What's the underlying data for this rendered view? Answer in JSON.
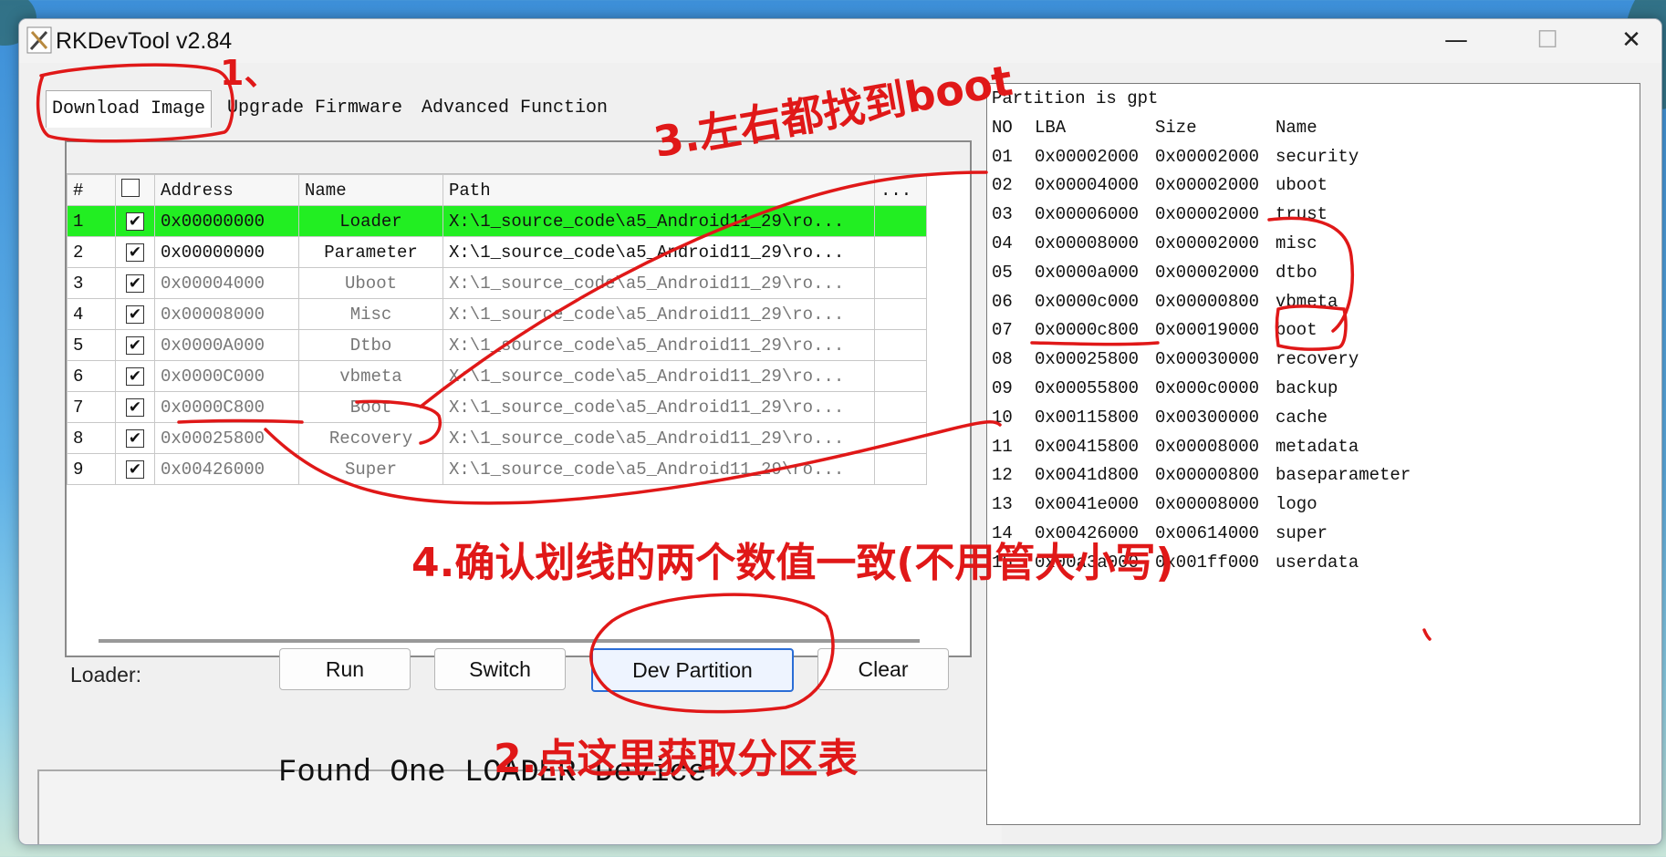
{
  "window": {
    "title": "RKDevTool v2.84",
    "min": "—",
    "max": "☐",
    "close": "✕"
  },
  "tabs": [
    "Download Image",
    "Upgrade Firmware",
    "Advanced Function"
  ],
  "grid": {
    "headers": [
      "#",
      "",
      "Address",
      "Name",
      "Path",
      "..."
    ],
    "rows": [
      {
        "num": "1",
        "checked": "✔",
        "address": "0x00000000",
        "name": "Loader",
        "path": "X:\\1_source_code\\a5_Android11_29\\ro..."
      },
      {
        "num": "2",
        "checked": "✔",
        "address": "0x00000000",
        "name": "Parameter",
        "path": "X:\\1_source_code\\a5_Android11_29\\ro..."
      },
      {
        "num": "3",
        "checked": "✔",
        "address": "0x00004000",
        "name": "Uboot",
        "path": "X:\\1_source_code\\a5_Android11_29\\ro..."
      },
      {
        "num": "4",
        "checked": "✔",
        "address": "0x00008000",
        "name": "Misc",
        "path": "X:\\1_source_code\\a5_Android11_29\\ro..."
      },
      {
        "num": "5",
        "checked": "✔",
        "address": "0x0000A000",
        "name": "Dtbo",
        "path": "X:\\1_source_code\\a5_Android11_29\\ro..."
      },
      {
        "num": "6",
        "checked": "✔",
        "address": "0x0000C000",
        "name": "vbmeta",
        "path": "X:\\1_source_code\\a5_Android11_29\\ro..."
      },
      {
        "num": "7",
        "checked": "✔",
        "address": "0x0000C800",
        "name": "Boot",
        "path": "X:\\1_source_code\\a5_Android11_29\\ro..."
      },
      {
        "num": "8",
        "checked": "✔",
        "address": "0x00025800",
        "name": "Recovery",
        "path": "X:\\1_source_code\\a5_Android11_29\\ro..."
      },
      {
        "num": "9",
        "checked": "✔",
        "address": "0x00426000",
        "name": "Super",
        "path": "X:\\1_source_code\\a5_Android11_29\\ro..."
      }
    ]
  },
  "loader_label": "Loader:",
  "buttons": {
    "run": "Run",
    "switch": "Switch",
    "dev_partition": "Dev Partition",
    "clear": "Clear"
  },
  "status": "Found One LOADER Device",
  "partition": {
    "header": "Partition is gpt",
    "columns": [
      "NO",
      "LBA",
      "Size",
      "Name"
    ],
    "rows": [
      [
        "01",
        "0x00002000",
        "0x00002000",
        "security"
      ],
      [
        "02",
        "0x00004000",
        "0x00002000",
        "uboot"
      ],
      [
        "03",
        "0x00006000",
        "0x00002000",
        "trust"
      ],
      [
        "04",
        "0x00008000",
        "0x00002000",
        "misc"
      ],
      [
        "05",
        "0x0000a000",
        "0x00002000",
        "dtbo"
      ],
      [
        "06",
        "0x0000c000",
        "0x00000800",
        "vbmeta"
      ],
      [
        "07",
        "0x0000c800",
        "0x00019000",
        "boot"
      ],
      [
        "08",
        "0x00025800",
        "0x00030000",
        "recovery"
      ],
      [
        "09",
        "0x00055800",
        "0x000c0000",
        "backup"
      ],
      [
        "10",
        "0x00115800",
        "0x00300000",
        "cache"
      ],
      [
        "11",
        "0x00415800",
        "0x00008000",
        "metadata"
      ],
      [
        "12",
        "0x0041d800",
        "0x00000800",
        "baseparameter"
      ],
      [
        "13",
        "0x0041e000",
        "0x00008000",
        "logo"
      ],
      [
        "14",
        "0x00426000",
        "0x00614000",
        "super"
      ],
      [
        "15",
        "0x00a3a000",
        "0x001ff000",
        "userdata"
      ]
    ]
  },
  "annotations": {
    "a1": "1、",
    "a2": "2.点这里获取分区表",
    "a3": "3.左右都找到boot",
    "a4": "4.确认划线的两个数值一致(不用管大小写)"
  }
}
